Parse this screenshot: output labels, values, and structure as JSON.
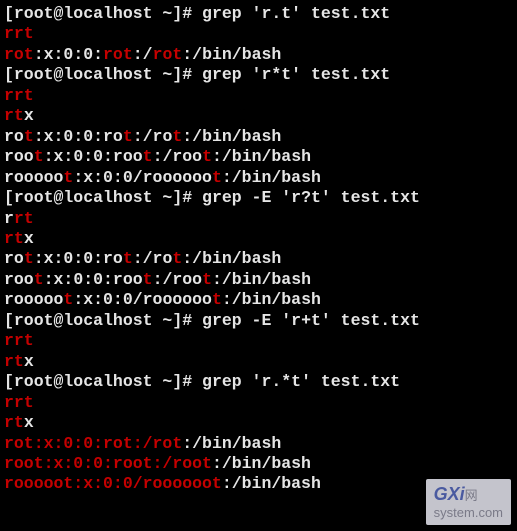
{
  "prompt_prefix": "[root@localhost ~]# ",
  "lines": [
    {
      "type": "cmd",
      "command": "grep 'r.t' test.txt"
    },
    {
      "type": "out",
      "segments": [
        {
          "t": "rrt",
          "h": true
        }
      ]
    },
    {
      "type": "out",
      "segments": [
        {
          "t": "rot",
          "h": true
        },
        {
          "t": ":x:0:0:",
          "h": false
        },
        {
          "t": "rot",
          "h": true
        },
        {
          "t": ":/",
          "h": false
        },
        {
          "t": "rot",
          "h": true
        },
        {
          "t": ":/bin/bash",
          "h": false
        }
      ]
    },
    {
      "type": "cmd",
      "command": "grep 'r*t' test.txt"
    },
    {
      "type": "out",
      "segments": [
        {
          "t": "rrt",
          "h": true
        }
      ]
    },
    {
      "type": "out",
      "segments": [
        {
          "t": "rt",
          "h": true
        },
        {
          "t": "x",
          "h": false
        }
      ]
    },
    {
      "type": "out",
      "segments": [
        {
          "t": "ro",
          "h": false
        },
        {
          "t": "t",
          "h": true
        },
        {
          "t": ":x:0:0:ro",
          "h": false
        },
        {
          "t": "t",
          "h": true
        },
        {
          "t": ":/ro",
          "h": false
        },
        {
          "t": "t",
          "h": true
        },
        {
          "t": ":/bin/bash",
          "h": false
        }
      ]
    },
    {
      "type": "out",
      "segments": [
        {
          "t": "roo",
          "h": false
        },
        {
          "t": "t",
          "h": true
        },
        {
          "t": ":x:0:0:roo",
          "h": false
        },
        {
          "t": "t",
          "h": true
        },
        {
          "t": ":/roo",
          "h": false
        },
        {
          "t": "t",
          "h": true
        },
        {
          "t": ":/bin/bash",
          "h": false
        }
      ]
    },
    {
      "type": "out",
      "segments": [
        {
          "t": "rooooo",
          "h": false
        },
        {
          "t": "t",
          "h": true
        },
        {
          "t": ":x:0:0/roooooo",
          "h": false
        },
        {
          "t": "t",
          "h": true
        },
        {
          "t": ":/bin/bash",
          "h": false
        }
      ]
    },
    {
      "type": "cmd",
      "command": "grep -E 'r?t' test.txt"
    },
    {
      "type": "out",
      "segments": [
        {
          "t": "r",
          "h": false
        },
        {
          "t": "rt",
          "h": true
        }
      ]
    },
    {
      "type": "out",
      "segments": [
        {
          "t": "rt",
          "h": true
        },
        {
          "t": "x",
          "h": false
        }
      ]
    },
    {
      "type": "out",
      "segments": [
        {
          "t": "ro",
          "h": false
        },
        {
          "t": "t",
          "h": true
        },
        {
          "t": ":x:0:0:ro",
          "h": false
        },
        {
          "t": "t",
          "h": true
        },
        {
          "t": ":/ro",
          "h": false
        },
        {
          "t": "t",
          "h": true
        },
        {
          "t": ":/bin/bash",
          "h": false
        }
      ]
    },
    {
      "type": "out",
      "segments": [
        {
          "t": "roo",
          "h": false
        },
        {
          "t": "t",
          "h": true
        },
        {
          "t": ":x:0:0:roo",
          "h": false
        },
        {
          "t": "t",
          "h": true
        },
        {
          "t": ":/roo",
          "h": false
        },
        {
          "t": "t",
          "h": true
        },
        {
          "t": ":/bin/bash",
          "h": false
        }
      ]
    },
    {
      "type": "out",
      "segments": [
        {
          "t": "rooooo",
          "h": false
        },
        {
          "t": "t",
          "h": true
        },
        {
          "t": ":x:0:0/roooooo",
          "h": false
        },
        {
          "t": "t",
          "h": true
        },
        {
          "t": ":/bin/bash",
          "h": false
        }
      ]
    },
    {
      "type": "cmd",
      "command": "grep -E 'r+t' test.txt"
    },
    {
      "type": "out",
      "segments": [
        {
          "t": "rrt",
          "h": true
        }
      ]
    },
    {
      "type": "out",
      "segments": [
        {
          "t": "rt",
          "h": true
        },
        {
          "t": "x",
          "h": false
        }
      ]
    },
    {
      "type": "cmd",
      "command": "grep 'r.*t' test.txt"
    },
    {
      "type": "out",
      "segments": [
        {
          "t": "rrt",
          "h": true
        }
      ]
    },
    {
      "type": "out",
      "segments": [
        {
          "t": "rt",
          "h": true
        },
        {
          "t": "x",
          "h": false
        }
      ]
    },
    {
      "type": "out",
      "segments": [
        {
          "t": "rot:x:0:0:rot:/rot",
          "h": true
        },
        {
          "t": ":/bin/bash",
          "h": false
        }
      ]
    },
    {
      "type": "out",
      "segments": [
        {
          "t": "root:x:0:0:root:/root",
          "h": true
        },
        {
          "t": ":/bin/bash",
          "h": false
        }
      ]
    },
    {
      "type": "out",
      "segments": [
        {
          "t": "rooooot:x:0:0/roooooot",
          "h": true
        },
        {
          "t": ":/bin/bash",
          "h": false
        }
      ]
    }
  ],
  "watermark": {
    "brand": "GXi",
    "suffix": "网",
    "domain": "system.com"
  }
}
